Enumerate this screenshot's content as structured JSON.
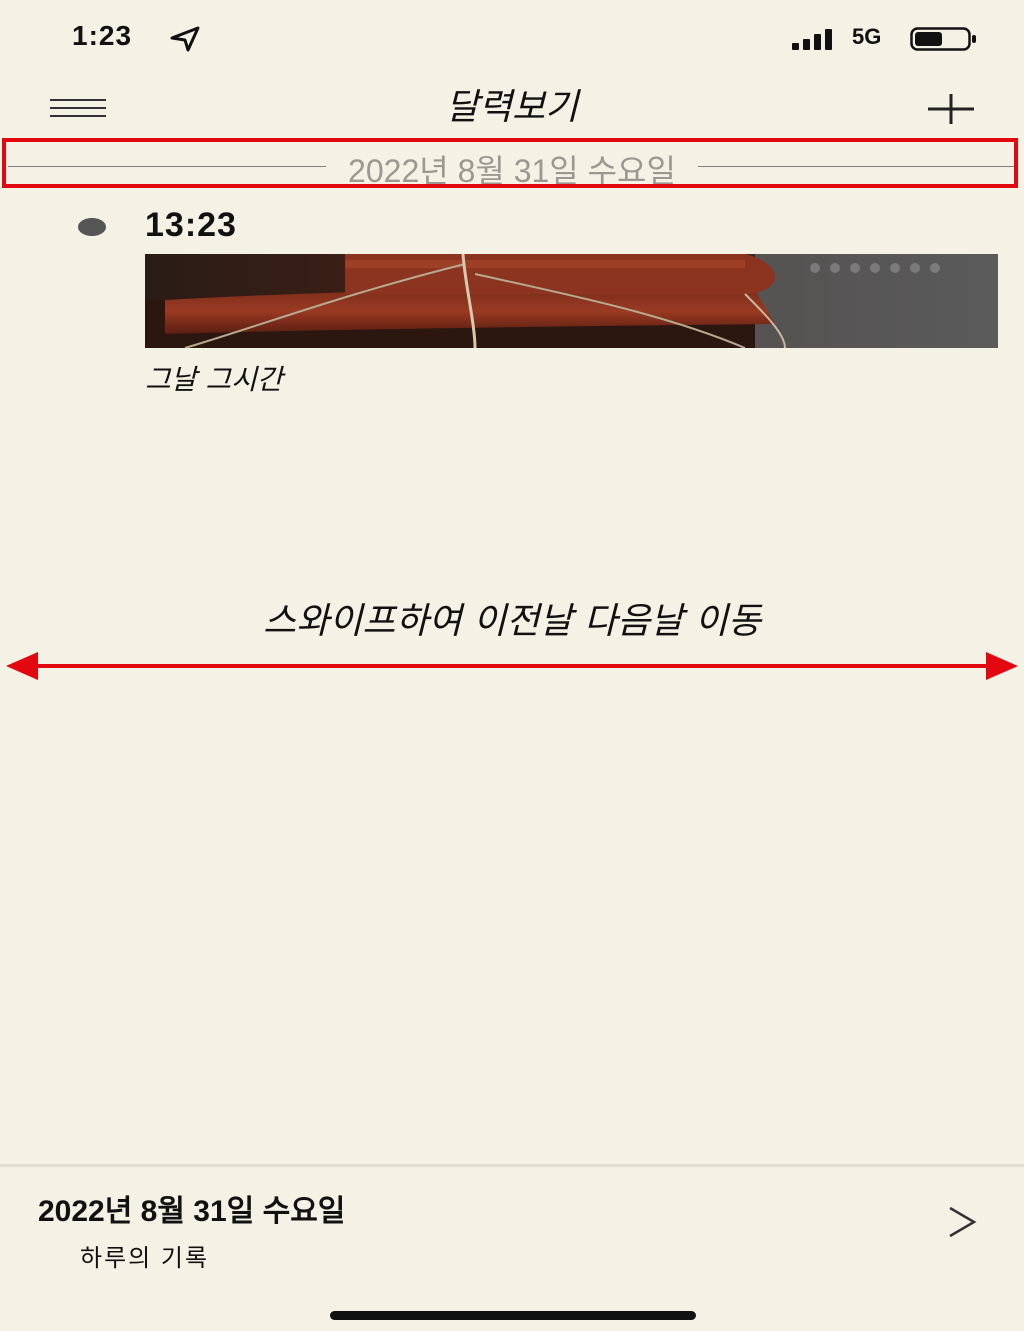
{
  "status_bar": {
    "time": "1:23",
    "network": "5G",
    "icons": [
      "location-arrow-icon",
      "signal-bars-icon",
      "battery-icon"
    ]
  },
  "nav": {
    "title": "달력보기",
    "menu_icon": "hamburger-menu-icon",
    "add_icon": "plus-icon"
  },
  "date_header": {
    "label": "2022년 8월 31일 수요일"
  },
  "entry": {
    "time": "13:23",
    "title": "그날 그시간",
    "photo": "red telephone receiver with cord"
  },
  "swipe_hint": {
    "text": "스와이프하여 이전날 다음날 이동"
  },
  "footer": {
    "date": "2022년 8월 31일 수요일",
    "subtitle": "하루의 기록",
    "next_label": ">"
  },
  "colors": {
    "background": "#f4f1e5",
    "annotation_red": "#e3070f",
    "muted_text": "#9a9890"
  }
}
